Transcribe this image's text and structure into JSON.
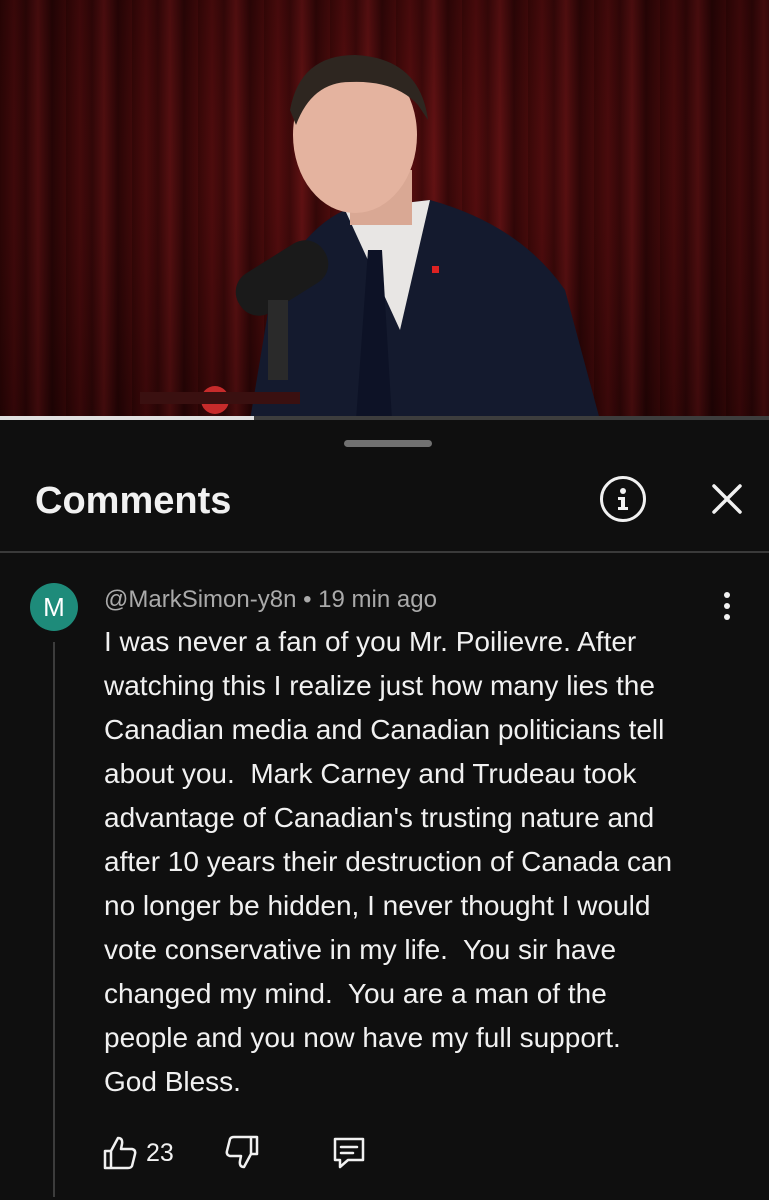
{
  "video": {
    "progress_fraction": 0.33
  },
  "comments_panel": {
    "title": "Comments",
    "info_icon": "info-circle-icon",
    "close_icon": "close-icon"
  },
  "comment": {
    "avatar_initial": "M",
    "avatar_color": "#1e8b7a",
    "handle": "@MarkSimon-y8n",
    "separator": "•",
    "time_ago": "19 min ago",
    "text_lines": [
      "I was never a fan of you Mr. Poilievre. After",
      "watching this I realize just how many lies the",
      "Canadian media and Canadian politicians tell",
      "about you.  Mark Carney and Trudeau took",
      "advantage of Canadian's trusting nature and",
      "after 10 years their destruction of Canada can",
      "no longer be hidden, I never thought I would",
      "vote conservative in my life.  You sir have",
      "changed my mind.  You are a man of the",
      "people and you now have my full support.",
      "God Bless."
    ],
    "like_count": "23",
    "icons": [
      "thumbs-up-icon",
      "thumbs-down-icon",
      "reply-icon",
      "more-vertical-icon"
    ]
  }
}
